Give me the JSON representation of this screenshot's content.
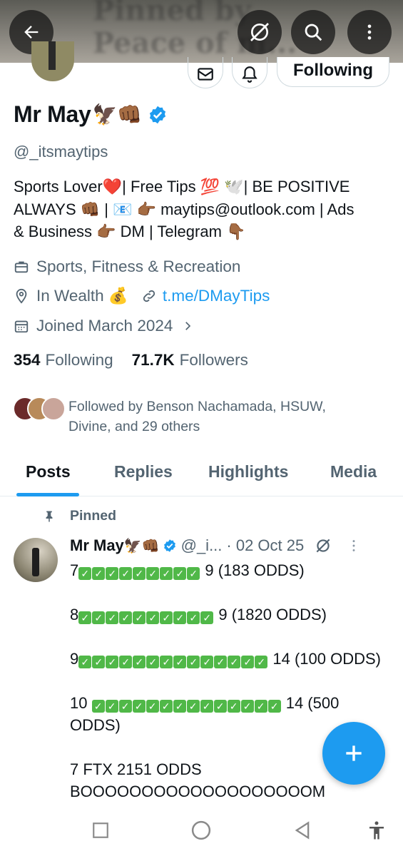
{
  "header": {
    "banner_text": "Pinned by\nPeace of m...",
    "back_icon": "back-arrow-icon",
    "grok_icon": "grok-icon",
    "search_icon": "search-icon",
    "more_icon": "more-vertical-icon"
  },
  "profile": {
    "follow_button": "Following",
    "name": "Mr May",
    "name_emoji": "🦅👊🏾",
    "handle": "@_itsmaytips",
    "bio_lines": [
      "Sports Lover❤️| Free Tips 💯 🕊️| BE POSITIVE",
      "ALWAYS 👊🏾 | 📧 👉🏾 maytips@outlook.com | Ads",
      "& Business 👉🏾 DM | Telegram 👇🏾"
    ],
    "category": "Sports, Fitness & Recreation",
    "location": "In Wealth 💰",
    "link": "t.me/DMayTips",
    "joined": "Joined March 2024",
    "following_count": "354",
    "following_label": "Following",
    "followers_count": "71.7K",
    "followers_label": "Followers",
    "followed_by": "Followed by Benson Nachamada, HSUW, Divine, and 29 others"
  },
  "tabs": [
    "Posts",
    "Replies",
    "Highlights",
    "Media"
  ],
  "post": {
    "pinned_label": "Pinned",
    "author_name": "Mr May",
    "author_emoji": "🦅👊🏾",
    "author_handle": "@_i...",
    "date": "· 02 Oct 25",
    "lines": [
      {
        "prefix": "7",
        "checks": 9,
        "suffix": " 9 (183 ODDS)"
      },
      {
        "prefix": "8",
        "checks": 10,
        "suffix": " 9 (1820 ODDS)"
      },
      {
        "prefix": "9",
        "checks": 14,
        "suffix": " 14 (100 ODDS)"
      },
      {
        "prefix": "10 ",
        "checks": 14,
        "suffix": " 14 (500 ODDS)"
      }
    ],
    "line_1": "7",
    "line_1_end": " 9 (183 ODDS)",
    "line_2": "8",
    "line_2_end": " 9 (1820 ODDS)",
    "line_3": "9",
    "line_3_end": " 14 (100 ODDS)",
    "line_4": "10 ",
    "line_4_end": " 14 (500",
    "line_4_cont": "ODDS)",
    "line_5": "7 FTX 2151 ODDS",
    "line_6": "BOOOOOOOOOOOOOOOOOOOM"
  },
  "colors": {
    "accent": "#1d9bf0",
    "text": "#0f1419",
    "secondary": "#536471",
    "check_green": "#50b848"
  }
}
